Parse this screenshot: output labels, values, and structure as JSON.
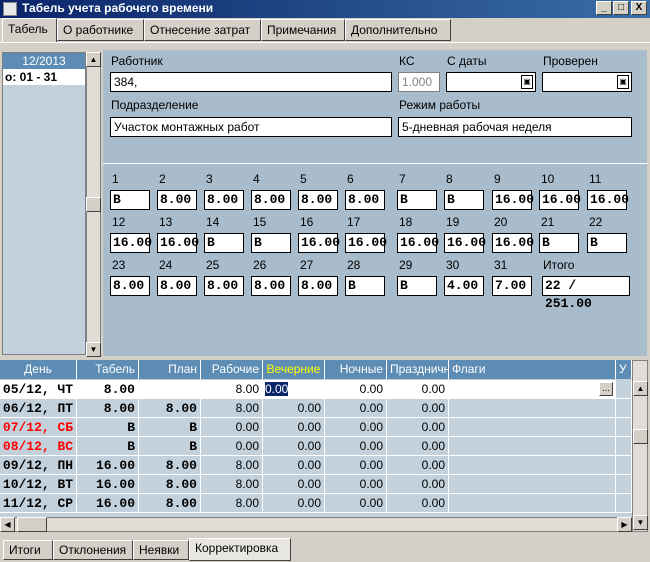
{
  "window": {
    "title": "Табель учета рабочего времени",
    "min": "_",
    "max": "□",
    "close": "X"
  },
  "tabs": [
    "Табель",
    "О работнике",
    "Отнесение затрат",
    "Примечания",
    "Дополнительно"
  ],
  "left": {
    "month": "12/2013",
    "period": "о: 01 - 31"
  },
  "form": {
    "worker_label": "Работник",
    "worker_value": "384,",
    "ks_label": "КС",
    "ks_value": "1.000",
    "from_label": "С даты",
    "checked_label": "Проверен",
    "dept_label": "Подразделение",
    "dept_value": "Участок монтажных работ",
    "mode_label": "Режим работы",
    "mode_value": "5-дневная рабочая неделя"
  },
  "days": [
    {
      "n": "1",
      "v": "В"
    },
    {
      "n": "2",
      "v": "8.00"
    },
    {
      "n": "3",
      "v": "8.00"
    },
    {
      "n": "4",
      "v": "8.00"
    },
    {
      "n": "5",
      "v": "8.00"
    },
    {
      "n": "6",
      "v": "8.00"
    },
    {
      "n": "7",
      "v": "В"
    },
    {
      "n": "8",
      "v": "В"
    },
    {
      "n": "9",
      "v": "16.00"
    },
    {
      "n": "10",
      "v": "16.00"
    },
    {
      "n": "11",
      "v": "16.00"
    },
    {
      "n": "12",
      "v": "16.00"
    },
    {
      "n": "13",
      "v": "16.00"
    },
    {
      "n": "14",
      "v": "В"
    },
    {
      "n": "15",
      "v": "В"
    },
    {
      "n": "16",
      "v": "16.00"
    },
    {
      "n": "17",
      "v": "16.00"
    },
    {
      "n": "18",
      "v": "16.00"
    },
    {
      "n": "19",
      "v": "16.00"
    },
    {
      "n": "20",
      "v": "16.00"
    },
    {
      "n": "21",
      "v": "В"
    },
    {
      "n": "22",
      "v": "В"
    },
    {
      "n": "23",
      "v": "8.00"
    },
    {
      "n": "24",
      "v": "8.00"
    },
    {
      "n": "25",
      "v": "8.00"
    },
    {
      "n": "26",
      "v": "8.00"
    },
    {
      "n": "27",
      "v": "8.00"
    },
    {
      "n": "28",
      "v": "В"
    },
    {
      "n": "29",
      "v": "В"
    },
    {
      "n": "30",
      "v": "4.00"
    },
    {
      "n": "31",
      "v": "7.00"
    }
  ],
  "total": {
    "label": "Итого",
    "value": "22 / 251.00"
  },
  "grid": {
    "headers": [
      "День",
      "Табель",
      "План",
      "Рабочие",
      "Вечерние",
      "Ночные",
      "Праздничные",
      "Флаги",
      "У"
    ],
    "highlight_color": "#ffff00",
    "weekend_color": "#ff0000",
    "rows": [
      [
        "05/12, ЧТ",
        "8.00",
        "",
        "8.00",
        "0.00",
        "0.00",
        "0.00"
      ],
      [
        "06/12, ПТ",
        "8.00",
        "8.00",
        "8.00",
        "0.00",
        "0.00",
        "0.00"
      ],
      [
        "07/12, СБ",
        "В",
        "В",
        "0.00",
        "0.00",
        "0.00",
        "0.00"
      ],
      [
        "08/12, ВС",
        "В",
        "В",
        "0.00",
        "0.00",
        "0.00",
        "0.00"
      ],
      [
        "09/12, ПН",
        "16.00",
        "8.00",
        "8.00",
        "0.00",
        "0.00",
        "0.00"
      ],
      [
        "10/12, ВТ",
        "16.00",
        "8.00",
        "8.00",
        "0.00",
        "0.00",
        "0.00"
      ],
      [
        "11/12, СР",
        "16.00",
        "8.00",
        "8.00",
        "0.00",
        "0.00",
        "0.00"
      ]
    ]
  },
  "bottom_tabs": [
    "Итоги",
    "Отклонения",
    "Неявки",
    "Корректировка"
  ]
}
